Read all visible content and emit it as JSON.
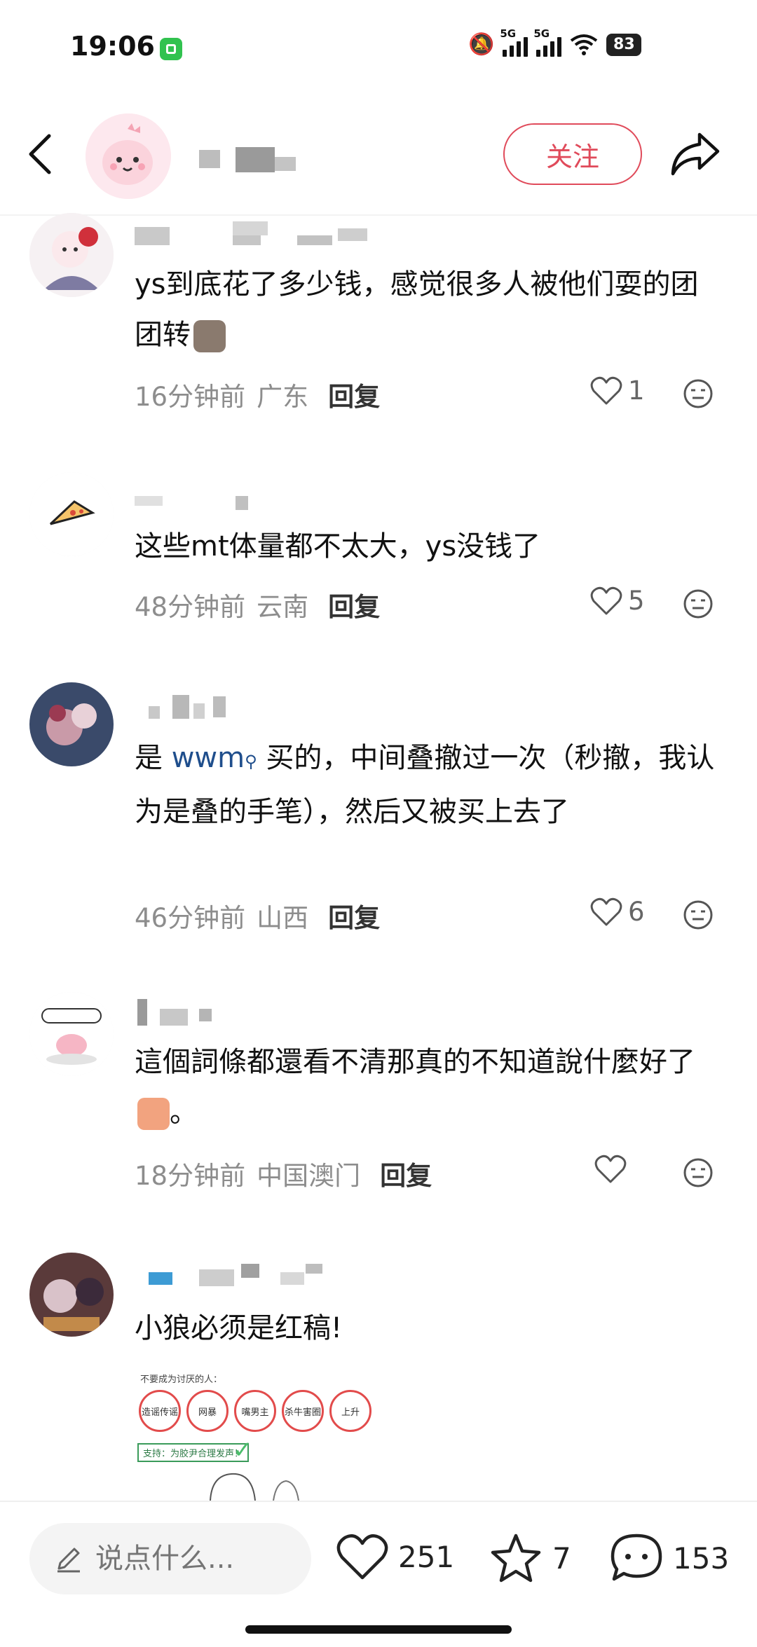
{
  "status_bar": {
    "time": "19:06",
    "network_1": "5G",
    "network_2": "5G",
    "battery": "83"
  },
  "header": {
    "follow_label": "关注"
  },
  "comments": [
    {
      "text": "ys到底花了多少钱，感觉很多人被他们耍的团团转",
      "time": "16分钟前",
      "location": "广东",
      "reply_label": "回复",
      "likes": "1"
    },
    {
      "text": "这些mt体量都不太大，ys没钱了",
      "time": "48分钟前",
      "location": "云南",
      "reply_label": "回复",
      "likes": "5"
    },
    {
      "text_prefix": "是 ",
      "link": "wwm",
      "text_suffix": " 买的，中间叠撤过一次（秒撤，我认为是叠的手笔），然后又被买上去了",
      "time": "46分钟前",
      "location": "山西",
      "reply_label": "回复",
      "likes": "6"
    },
    {
      "text": "這個詞條都還看不清那真的不知道說什麼好了",
      "text_end": "。",
      "time": "18分钟前",
      "location": "中国澳门",
      "reply_label": "回复",
      "likes": ""
    },
    {
      "text": "小狼必须是红稿!"
    }
  ],
  "sticker": {
    "title": "不要成为讨厌的人：",
    "items": [
      "造谣传谣",
      "网暴",
      "嘴男主",
      "杀牛害圈",
      "上升"
    ],
    "support": "支持：为胶尹合理发声！"
  },
  "bottom_bar": {
    "input_placeholder": "说点什么...",
    "likes": "251",
    "favorites": "7",
    "comments": "153"
  },
  "colors": {
    "accent": "#e04a5a",
    "link": "#1f4e8c",
    "meta": "#8d8d8d"
  }
}
